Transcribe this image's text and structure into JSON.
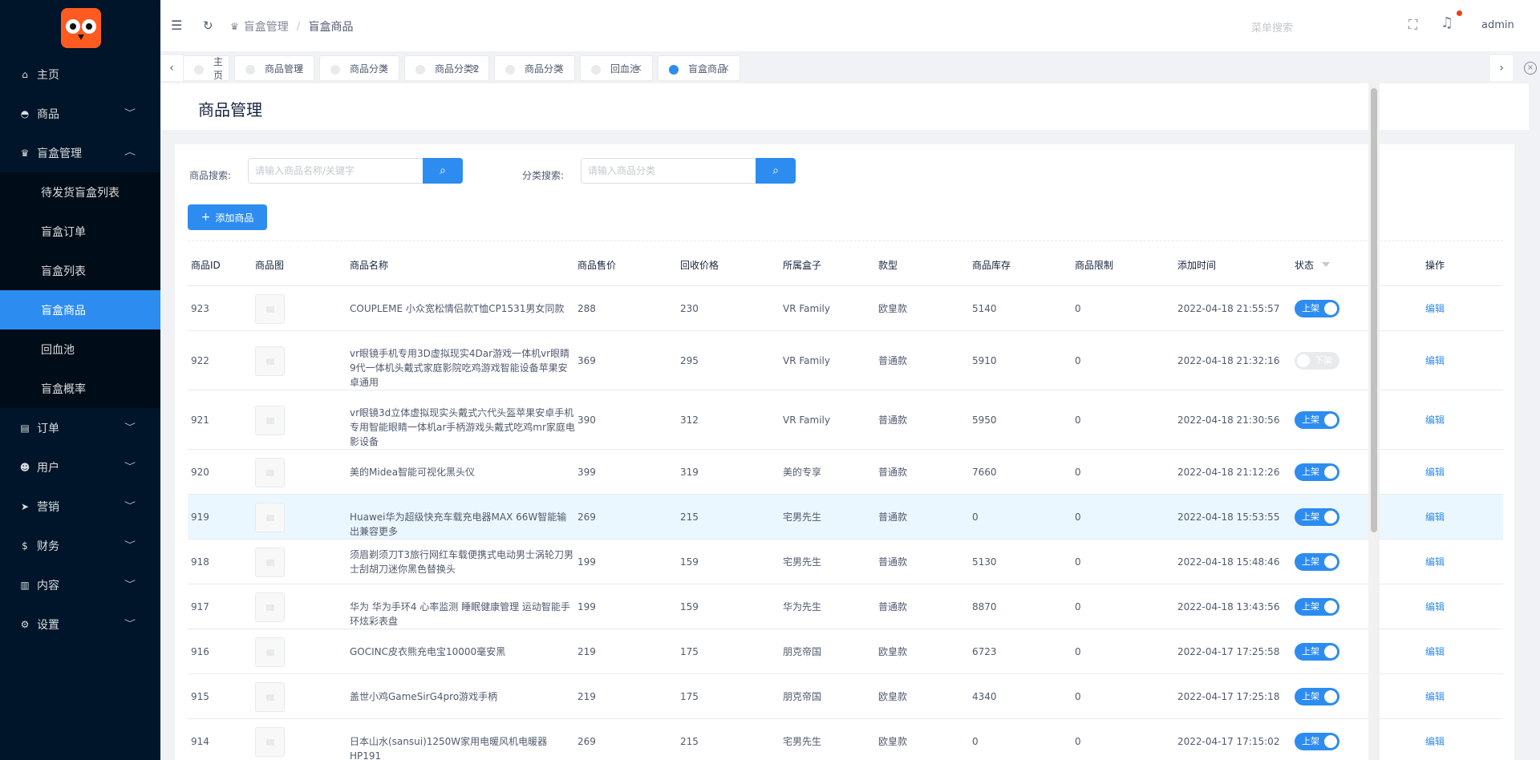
{
  "sidebar": {
    "items": [
      {
        "label": "主页",
        "icon": "home-icon",
        "glyph": "⌂",
        "chev": ""
      },
      {
        "label": "商品",
        "icon": "basket-icon",
        "glyph": "◓",
        "chev": "﹀"
      },
      {
        "label": "盲盒管理",
        "icon": "trophy-icon",
        "glyph": "♛",
        "chev": "︿"
      }
    ],
    "sub_items": [
      {
        "label": "待发货盲盒列表"
      },
      {
        "label": "盲盒订单"
      },
      {
        "label": "盲盒列表"
      },
      {
        "label": "盲盒商品"
      },
      {
        "label": "回血池"
      },
      {
        "label": "盲盒概率"
      }
    ],
    "bottom_items": [
      {
        "label": "订单",
        "icon": "cart-icon",
        "glyph": "▤",
        "chev": "﹀"
      },
      {
        "label": "用户",
        "icon": "user-icon",
        "glyph": "☻",
        "chev": "﹀"
      },
      {
        "label": "营销",
        "icon": "send-icon",
        "glyph": "➤",
        "chev": "﹀"
      },
      {
        "label": "财务",
        "icon": "dollar-icon",
        "glyph": "$",
        "chev": "﹀"
      },
      {
        "label": "内容",
        "icon": "book-icon",
        "glyph": "▥",
        "chev": "﹀"
      },
      {
        "label": "设置",
        "icon": "gear-icon",
        "glyph": "⚙",
        "chev": "﹀"
      }
    ]
  },
  "topbar": {
    "breadcrumb_parent": "盲盒管理",
    "breadcrumb_sep": "/",
    "breadcrumb_current": "盲盒商品",
    "menu_search_placeholder": "菜单搜索",
    "user": "admin"
  },
  "tabs": [
    {
      "label": "主页",
      "close": ""
    },
    {
      "label": "商品管理",
      "close": "×"
    },
    {
      "label": "商品分类",
      "close": "×"
    },
    {
      "label": "商品分类2",
      "close": "×"
    },
    {
      "label": "商品分类",
      "close": "×"
    },
    {
      "label": "回血池",
      "close": "×"
    },
    {
      "label": "盲盒商品",
      "close": "×"
    }
  ],
  "page": {
    "title": "商品管理",
    "search_label": "商品搜索:",
    "search_placeholder": "请输入商品名称/关键字",
    "category_label": "分类搜索:",
    "category_placeholder": "请输入商品分类",
    "add_button": "添加商品"
  },
  "table": {
    "columns": [
      "商品ID",
      "商品图",
      "商品名称",
      "商品售价",
      "回收价格",
      "所属盒子",
      "款型",
      "商品库存",
      "商品限制",
      "添加时间",
      "状态",
      "操作"
    ],
    "rows": [
      {
        "id": "923",
        "name": "COUPLEME 小众宽松情侣款T恤CP1531男女同款",
        "price": "288",
        "recycle": "230",
        "box": "VR Family",
        "style": "欧皇款",
        "stock": "5140",
        "limit": "0",
        "time": "2022-04-18 21:55:57",
        "status": "上架",
        "on": true,
        "action": "编辑"
      },
      {
        "id": "922",
        "name": "vr眼镜手机专用3D虚拟现实4Dar游戏一体机vr眼睛 9代一体机头戴式家庭影院吃鸡游戏智能设备苹果安卓通用",
        "price": "369",
        "recycle": "295",
        "box": "VR Family",
        "style": "普通款",
        "stock": "5910",
        "limit": "0",
        "time": "2022-04-18 21:32:16",
        "status": "下架",
        "on": false,
        "action": "编辑"
      },
      {
        "id": "921",
        "name": "vr眼镜3d立体虚拟现实头戴式六代头盔苹果安卓手机专用智能眼睛一体机ar手柄游戏头戴式吃鸡mr家庭电影设备",
        "price": "390",
        "recycle": "312",
        "box": "VR Family",
        "style": "普通款",
        "stock": "5950",
        "limit": "0",
        "time": "2022-04-18 21:30:56",
        "status": "上架",
        "on": true,
        "action": "编辑"
      },
      {
        "id": "920",
        "name": "美的Midea智能可视化黑头仪",
        "price": "399",
        "recycle": "319",
        "box": "美的专享",
        "style": "普通款",
        "stock": "7660",
        "limit": "0",
        "time": "2022-04-18 21:12:26",
        "status": "上架",
        "on": true,
        "action": "编辑"
      },
      {
        "id": "919",
        "name": "Huawei华为超级快充车载充电器MAX 66W智能输出兼容更多",
        "price": "269",
        "recycle": "215",
        "box": "宅男先生",
        "style": "普通款",
        "stock": "0",
        "limit": "0",
        "time": "2022-04-18 15:53:55",
        "status": "上架",
        "on": true,
        "action": "编辑"
      },
      {
        "id": "918",
        "name": "须眉剃须刀T3旅行网红车载便携式电动男士涡轮刀男士刮胡刀迷你黑色替换头",
        "price": "199",
        "recycle": "159",
        "box": "宅男先生",
        "style": "普通款",
        "stock": "5130",
        "limit": "0",
        "time": "2022-04-18 15:48:46",
        "status": "上架",
        "on": true,
        "action": "编辑"
      },
      {
        "id": "917",
        "name": "华为 华为手环4 心率监测 睡眠健康管理 运动智能手环炫彩表盘",
        "price": "199",
        "recycle": "159",
        "box": "华为先生",
        "style": "普通款",
        "stock": "8870",
        "limit": "0",
        "time": "2022-04-18 13:43:56",
        "status": "上架",
        "on": true,
        "action": "编辑"
      },
      {
        "id": "916",
        "name": "GOCINC皮衣熊充电宝10000毫安黑",
        "price": "219",
        "recycle": "175",
        "box": "朋克帝国",
        "style": "欧皇款",
        "stock": "6723",
        "limit": "0",
        "time": "2022-04-17 17:25:58",
        "status": "上架",
        "on": true,
        "action": "编辑"
      },
      {
        "id": "915",
        "name": "盖世小鸡GameSirG4pro游戏手柄",
        "price": "219",
        "recycle": "175",
        "box": "朋克帝国",
        "style": "欧皇款",
        "stock": "4340",
        "limit": "0",
        "time": "2022-04-17 17:25:18",
        "status": "上架",
        "on": true,
        "action": "编辑"
      },
      {
        "id": "914",
        "name": "日本山水(sansui)1250W家用电暖风机电暖器HP191",
        "price": "269",
        "recycle": "215",
        "box": "宅男先生",
        "style": "欧皇款",
        "stock": "0",
        "limit": "0",
        "time": "2022-04-17 17:15:02",
        "status": "上架",
        "on": true,
        "action": "编辑"
      }
    ]
  }
}
